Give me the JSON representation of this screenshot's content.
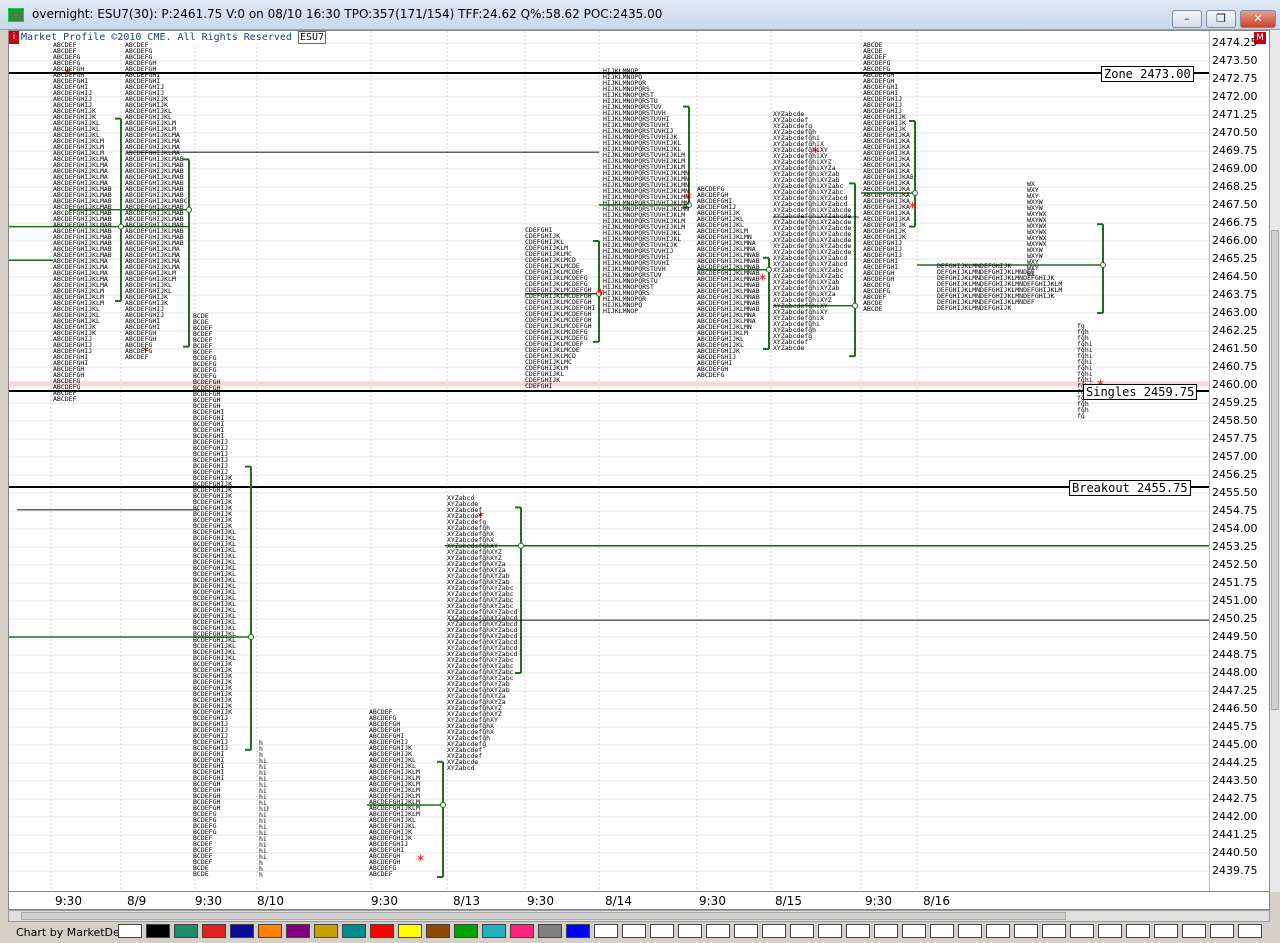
{
  "window": {
    "title": "overnight: ESU7(30): P:2461.75 V:0 on 08/10 16:30 TPO:357(171/154) TFF:24.62 Q%:58.62 POC:2435.00",
    "minimize": "–",
    "maximize": "❐",
    "close": "✕"
  },
  "header": {
    "copyright": "Market Profile ©2010 CME. All Rights Reserved",
    "symbol": "ESU7",
    "info_badge": "i",
    "m_badge": "M"
  },
  "y_axis": {
    "ticks": [
      "2474.25",
      "2473.50",
      "2472.75",
      "2472.00",
      "2471.25",
      "2470.50",
      "2469.75",
      "2469.00",
      "2468.25",
      "2467.50",
      "2466.75",
      "2466.00",
      "2465.25",
      "2464.50",
      "2463.75",
      "2463.00",
      "2462.25",
      "2461.50",
      "2460.75",
      "2460.00",
      "2459.25",
      "2458.50",
      "2457.75",
      "2457.00",
      "2456.25",
      "2455.50",
      "2454.75",
      "2454.00",
      "2453.25",
      "2452.50",
      "2451.75",
      "2451.00",
      "2450.25",
      "2449.50",
      "2448.75",
      "2448.00",
      "2447.25",
      "2446.50",
      "2445.75",
      "2445.00",
      "2444.25",
      "2443.50",
      "2442.75",
      "2442.00",
      "2441.25",
      "2440.50",
      "2439.75"
    ]
  },
  "levels": [
    {
      "label": "Zone 2473.00",
      "price": 2473.0
    },
    {
      "label": "Singles 2459.75",
      "price": 2459.75
    },
    {
      "label": "Breakout 2455.75",
      "price": 2455.75
    }
  ],
  "x_axis": {
    "labels": [
      "9:30",
      "8/9",
      "9:30",
      "8/10",
      "9:30",
      "8/13",
      "9:30",
      "8/14",
      "9:30",
      "8/15",
      "9:30",
      "8/16"
    ]
  },
  "status": {
    "credit": "Chart by MarketDelta"
  },
  "colors": {
    "tpo_text": "#000000",
    "value_area_line": "#1f6e1f",
    "level_line": "#000000",
    "poc_marker": "#ff0000",
    "swatches": [
      "#ffffff",
      "#000000",
      "#1e8c6e",
      "#e02020",
      "#0a0a9a",
      "#ff8000",
      "#800080",
      "#c8a000",
      "#008c8c",
      "#ff0000",
      "#ffff00",
      "#8c4a00",
      "#00a000",
      "#20b0c0",
      "#ff2080",
      "#808080",
      "#0000ff",
      "#ffffff",
      "#ffffff",
      "#ffffff",
      "#ffffff",
      "#ffffff",
      "#ffffff",
      "#ffffff",
      "#ffffff",
      "#ffffff",
      "#ffffff",
      "#ffffff",
      "#ffffff",
      "#ffffff",
      "#ffffff",
      "#ffffff",
      "#ffffff",
      "#ffffff",
      "#ffffff",
      "#ffffff",
      "#ffffff",
      "#ffffff",
      "#ffffff",
      "#ffffff",
      "#ffffff"
    ]
  }
}
